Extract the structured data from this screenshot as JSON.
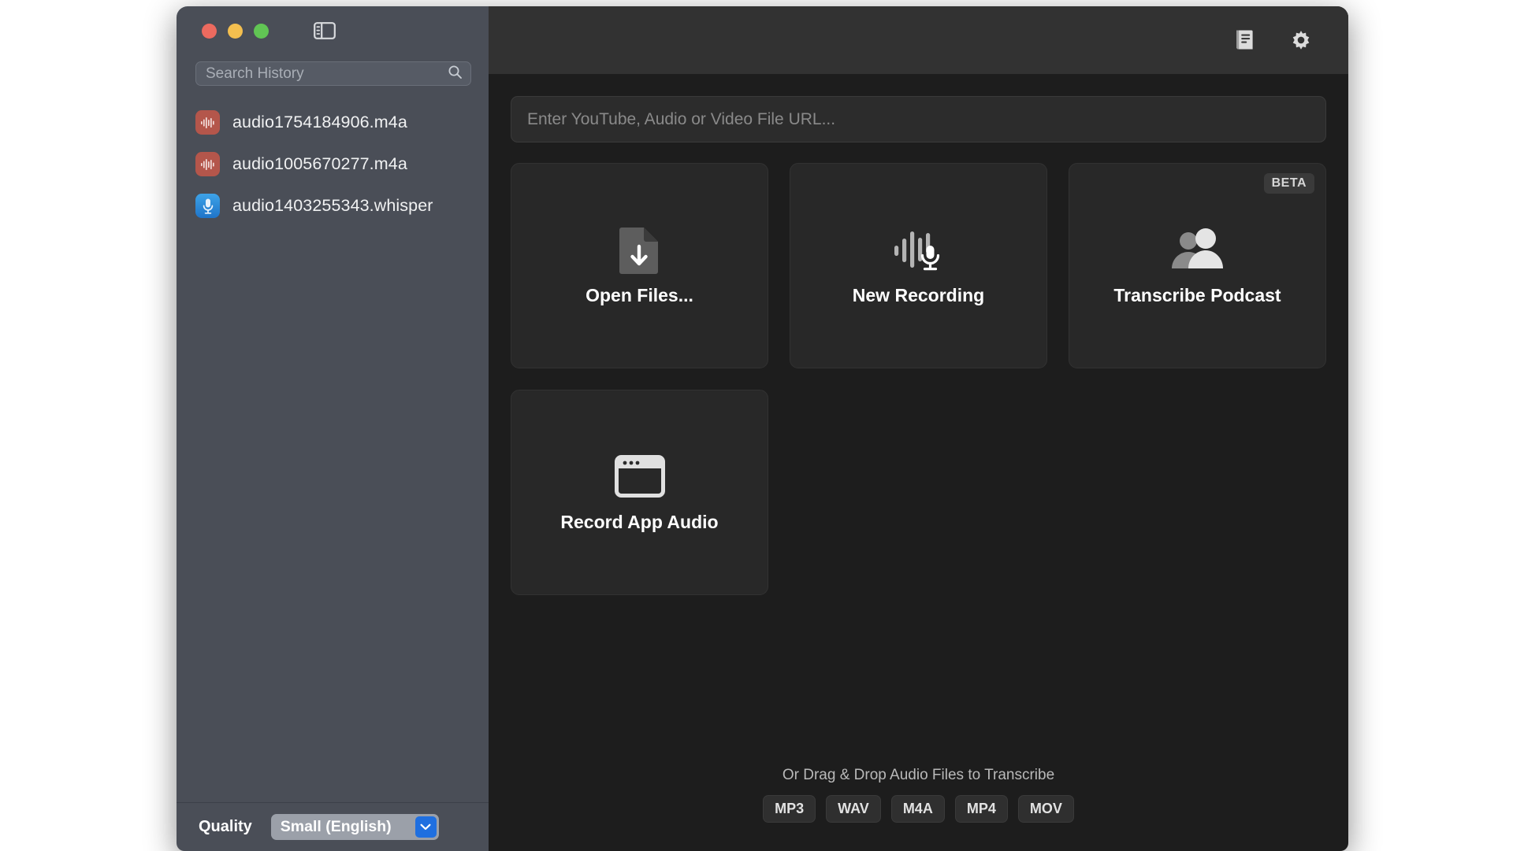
{
  "window": {
    "traffic_lights": [
      {
        "name": "close",
        "color": "#ec6a5f"
      },
      {
        "name": "minimize",
        "color": "#f4bf4f"
      },
      {
        "name": "maximize",
        "color": "#61c554"
      }
    ],
    "sidebar_toggle_icon": "sidebar-toggle-icon"
  },
  "sidebar": {
    "search": {
      "placeholder": "Search History",
      "value": "",
      "icon": "search-icon"
    },
    "history": [
      {
        "label": "audio1754184906.m4a",
        "icon": "audio-waveform-icon",
        "kind": "audio"
      },
      {
        "label": "audio1005670277.m4a",
        "icon": "audio-waveform-icon",
        "kind": "audio"
      },
      {
        "label": "audio1403255343.whisper",
        "icon": "microphone-icon",
        "kind": "whisper"
      }
    ],
    "quality": {
      "label": "Quality",
      "selected": "Small (English)",
      "chevron_icon": "chevron-down-icon",
      "accent": "#1f6fe0"
    }
  },
  "toolbar": {
    "icons": [
      {
        "name": "book-icon",
        "label": "Library"
      },
      {
        "name": "gear-icon",
        "label": "Settings"
      }
    ]
  },
  "main": {
    "url_field": {
      "placeholder": "Enter YouTube, Audio or Video File URL...",
      "value": ""
    },
    "cards": [
      {
        "label": "Open Files...",
        "icon": "file-download-icon",
        "badge": ""
      },
      {
        "label": "New Recording",
        "icon": "waveform-microphone-icon",
        "badge": ""
      },
      {
        "label": "Transcribe Podcast",
        "icon": "two-people-icon",
        "badge": "BETA"
      },
      {
        "label": "Record App Audio",
        "icon": "app-window-icon",
        "badge": ""
      }
    ],
    "drop_zone": {
      "text": "Or Drag & Drop Audio Files to Transcribe",
      "formats": [
        "MP3",
        "WAV",
        "M4A",
        "MP4",
        "MOV"
      ]
    }
  },
  "colors": {
    "sidebar_bg": "#4a4e57",
    "main_bg": "#1d1d1d",
    "card_bg": "#282828",
    "toolbar_bg": "#323232",
    "accent_blue": "#1f6fe0",
    "audio_icon_red": "#b4564b"
  }
}
